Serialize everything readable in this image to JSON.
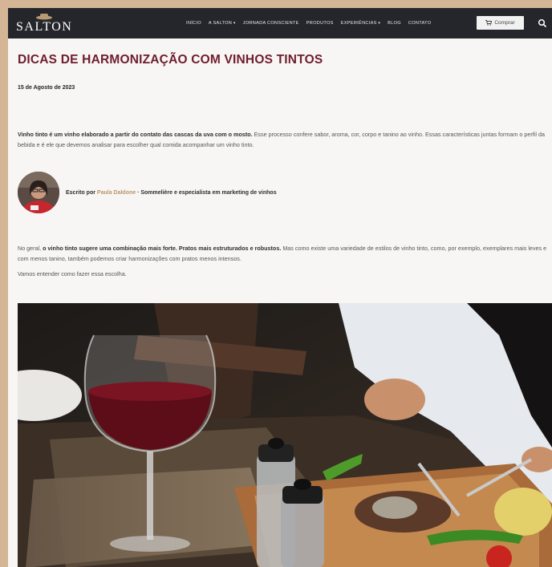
{
  "header": {
    "logo": "SALTON",
    "nav": [
      "INÍCIO",
      "A SALTON",
      "JORNADA CONSCIENTE",
      "PRODUTOS",
      "EXPERIÊNCIAS",
      "BLOG",
      "CONTATO"
    ],
    "nav_has_dropdown": [
      false,
      true,
      false,
      false,
      true,
      false,
      false
    ],
    "buy_label": "Comprar",
    "icons": {
      "cart": "cart-icon",
      "search": "search-icon",
      "dropdown": "chevron-down-icon"
    }
  },
  "article": {
    "title": "DICAS DE HARMONIZAÇÃO COM VINHOS TINTOS",
    "date": "15 de Agosto de 2023",
    "intro_bold": "Vinho tinto é um vinho elaborado a partir do contato das cascas da uva com o mosto.",
    "intro_rest": " Esse processo confere sabor, aroma, cor, corpo e tanino ao vinho. Essas características juntas formam o perfil da bebida e é ele que devemos analisar para escolher qual comida acompanhar um vinho tinto.",
    "author_prefix": "Escrito por",
    "author_name": "Paula Daldone",
    "author_role": " · Sommelière e especialista em marketing de vinhos",
    "p2_start": "No geral, ",
    "p2_bold": "o vinho tinto sugere uma combinação mais forte. Pratos mais estruturados e robustos.",
    "p2_rest": " Mas como existe uma variedade de estilos de vinho tinto, como, por exemplo, exemplares mais leves e com menos tanino, também podemos criar harmonizações com pratos menos intensos.",
    "p3": "Vamos entender como fazer essa escolha."
  },
  "colors": {
    "title": "#6e1d2c",
    "accent": "#b8976b",
    "header_bg": "#24262b",
    "page_bg": "#f8f6f4"
  }
}
